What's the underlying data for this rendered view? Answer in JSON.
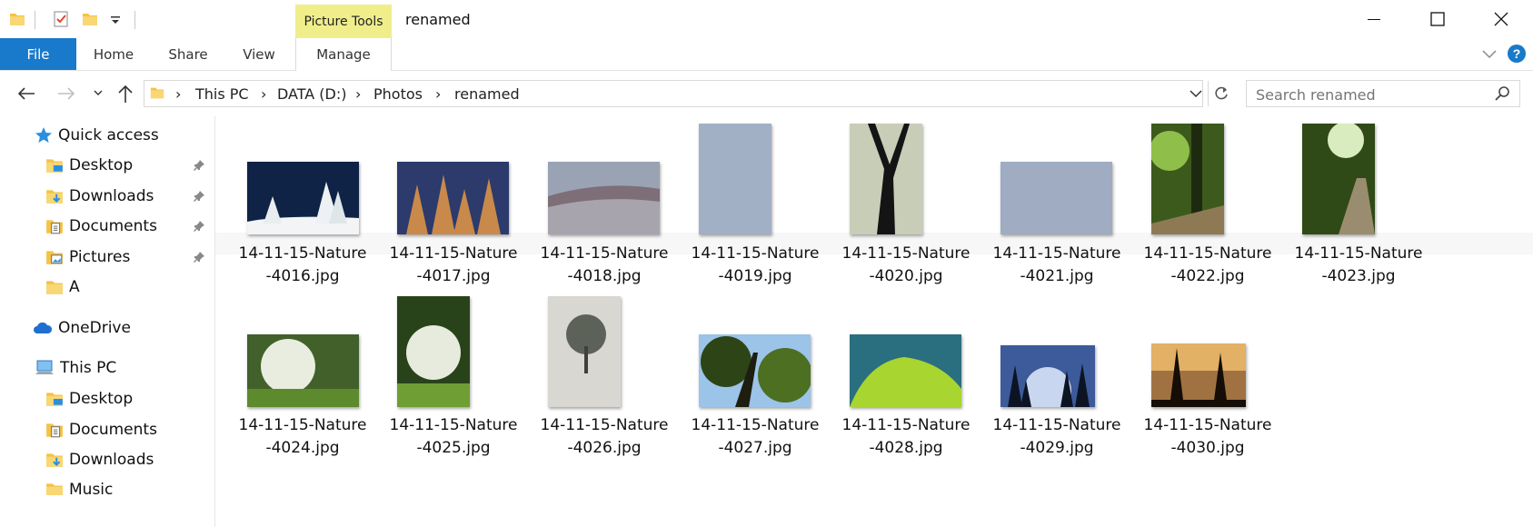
{
  "window": {
    "title": "renamed",
    "context_tab": "Picture Tools"
  },
  "ribbon": {
    "tabs": [
      "File",
      "Home",
      "Share",
      "View",
      "Manage"
    ]
  },
  "address": {
    "path": [
      "This PC",
      "DATA (D:)",
      "Photos",
      "renamed"
    ]
  },
  "search": {
    "placeholder": "Search renamed"
  },
  "nav": {
    "quick_access": "Quick access",
    "quick_items": [
      "Desktop",
      "Downloads",
      "Documents",
      "Pictures",
      "A"
    ],
    "onedrive": "OneDrive",
    "this_pc": "This PC",
    "pc_items": [
      "Desktop",
      "Documents",
      "Downloads",
      "Music"
    ]
  },
  "files": [
    {
      "line1": "14-11-15-Nature",
      "line2": "-4016.jpg"
    },
    {
      "line1": "14-11-15-Nature",
      "line2": "-4017.jpg"
    },
    {
      "line1": "14-11-15-Nature",
      "line2": "-4018.jpg"
    },
    {
      "line1": "14-11-15-Nature",
      "line2": "-4019.jpg"
    },
    {
      "line1": "14-11-15-Nature",
      "line2": "-4020.jpg"
    },
    {
      "line1": "14-11-15-Nature",
      "line2": "-4021.jpg"
    },
    {
      "line1": "14-11-15-Nature",
      "line2": "-4022.jpg"
    },
    {
      "line1": "14-11-15-Nature",
      "line2": "-4023.jpg"
    },
    {
      "line1": "14-11-15-Nature",
      "line2": "-4024.jpg"
    },
    {
      "line1": "14-11-15-Nature",
      "line2": "-4025.jpg"
    },
    {
      "line1": "14-11-15-Nature",
      "line2": "-4026.jpg"
    },
    {
      "line1": "14-11-15-Nature",
      "line2": "-4027.jpg"
    },
    {
      "line1": "14-11-15-Nature",
      "line2": "-4028.jpg"
    },
    {
      "line1": "14-11-15-Nature",
      "line2": "-4029.jpg"
    },
    {
      "line1": "14-11-15-Nature",
      "line2": "-4030.jpg"
    }
  ],
  "colors": {
    "accent": "#1979ca",
    "context_tab": "#f0ee8b",
    "folder": "#f5c242"
  },
  "icons": [
    "folder-icon",
    "properties-icon",
    "new-folder-icon",
    "customize-qat-icon",
    "minimize-icon",
    "maximize-icon",
    "close-icon",
    "collapse-ribbon-icon",
    "help-icon",
    "back-icon",
    "forward-icon",
    "recent-locations-icon",
    "up-icon",
    "address-dropdown-icon",
    "refresh-icon",
    "search-icon",
    "star-icon",
    "pin-icon",
    "onedrive-icon",
    "computer-icon"
  ]
}
